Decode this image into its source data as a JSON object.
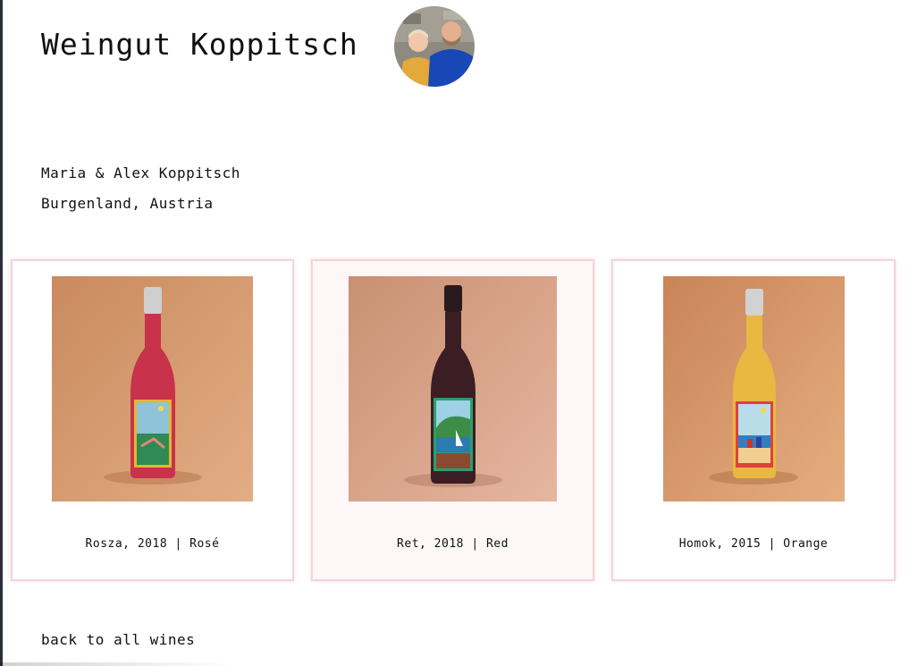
{
  "header": {
    "title": "Weingut Koppitsch"
  },
  "producer": {
    "names": "Maria & Alex Koppitsch",
    "region": "Burgenland, Austria"
  },
  "wines": [
    {
      "caption": "Rosza, 2018 | Rosé",
      "wine_color": "#c8324a"
    },
    {
      "caption": "Ret, 2018 | Red",
      "wine_color": "#3a1e24"
    },
    {
      "caption": "Homok, 2015 | Orange",
      "wine_color": "#e8b840"
    }
  ],
  "footer": {
    "back_link": "back to all wines"
  },
  "colors": {
    "card_border": "#f2d4d8",
    "photo_background": "#d9a07a",
    "text": "#111111"
  }
}
